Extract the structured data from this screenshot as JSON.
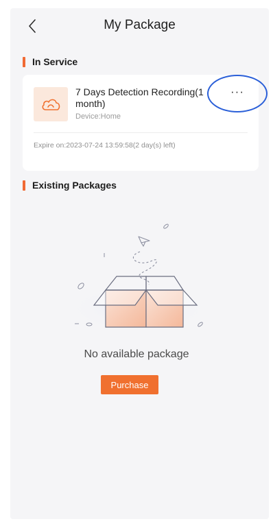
{
  "header": {
    "title": "My Package",
    "back_icon": "chevron-left-icon"
  },
  "in_service": {
    "section_title": "In Service",
    "package": {
      "name": "7 Days Detection Recording(1 month)",
      "device": "Device:Home",
      "more_label": "···",
      "expire": "Expire on:2023-07-24 13:59:58(2 day(s) left)",
      "icon": "cloud-icon"
    }
  },
  "existing": {
    "section_title": "Existing Packages",
    "empty_text": "No available package",
    "purchase_label": "Purchase",
    "illustration": "empty-box-illustration"
  },
  "colors": {
    "accent": "#f06a34",
    "highlight_ring": "#2a5fd8",
    "background": "#f5f5f7"
  }
}
